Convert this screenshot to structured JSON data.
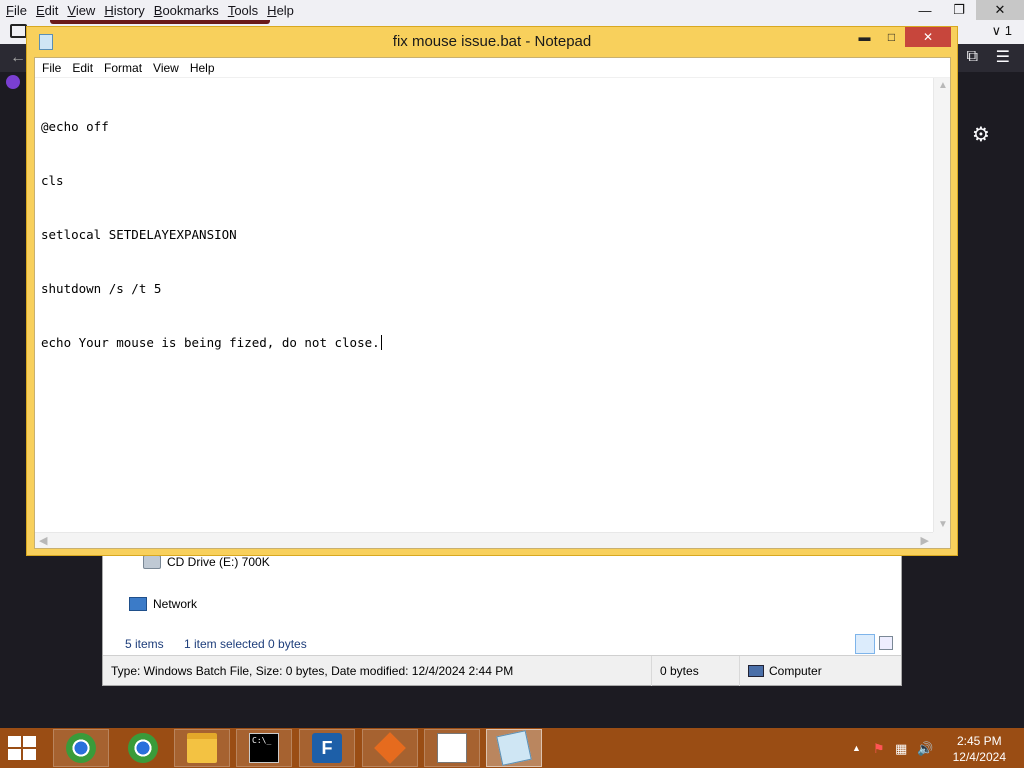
{
  "firefox": {
    "menu": [
      "File",
      "Edit",
      "View",
      "History",
      "Bookmarks",
      "Tools",
      "Help"
    ],
    "tab_count": "1",
    "min_glyph": "—",
    "restore_glyph": "❐",
    "close_glyph": "✕",
    "back_glyph": "←",
    "ext_glyph": "⧉",
    "menu_glyph": "☰",
    "gear_glyph": "⚙",
    "chevron_glyph": "∨"
  },
  "explorer": {
    "items": [
      {
        "label": "CD Drive (E:) 700K",
        "icon": "cd-drive-icon"
      },
      {
        "label": "Network",
        "icon": "network-icon"
      }
    ],
    "status": {
      "item_count": "5 items",
      "selected": "1 item selected  0 bytes"
    },
    "details": {
      "type_info": "Type: Windows Batch File, Size: 0 bytes, Date modified: 12/4/2024 2:44 PM",
      "size": "0 bytes",
      "location": "Computer"
    }
  },
  "notepad": {
    "title": "fix mouse issue.bat - Notepad",
    "menu": [
      "File",
      "Edit",
      "Format",
      "View",
      "Help"
    ],
    "lines": [
      "@echo off",
      "cls",
      "setlocal SETDELAYEXPANSION",
      "shutdown /s /t 5",
      "echo Your mouse is being fized, do not close."
    ],
    "controls": {
      "min": "▬",
      "max": "□",
      "close": "✕"
    },
    "scroll": {
      "up": "▲",
      "down": "▼",
      "left": "◀",
      "right": "▶",
      "grip": "⋰"
    }
  },
  "taskbar": {
    "apps": [
      "chrome-icon",
      "chrome-icon",
      "file-explorer-icon",
      "command-prompt-icon",
      "filezilla-icon",
      "box-app-icon",
      "task-list-icon",
      "notepad-icon"
    ],
    "cmd_text": "C:\\_",
    "fz_text": "F",
    "tray": {
      "chevron": "▲",
      "flag": "⚑",
      "net": "▦",
      "sound": "🔊"
    },
    "clock": {
      "time": "2:45 PM",
      "date": "12/4/2024"
    }
  },
  "colors": {
    "notepad_frame": "#f8d05c",
    "taskbar": "#9a4d14",
    "close_button": "#c7463c"
  }
}
